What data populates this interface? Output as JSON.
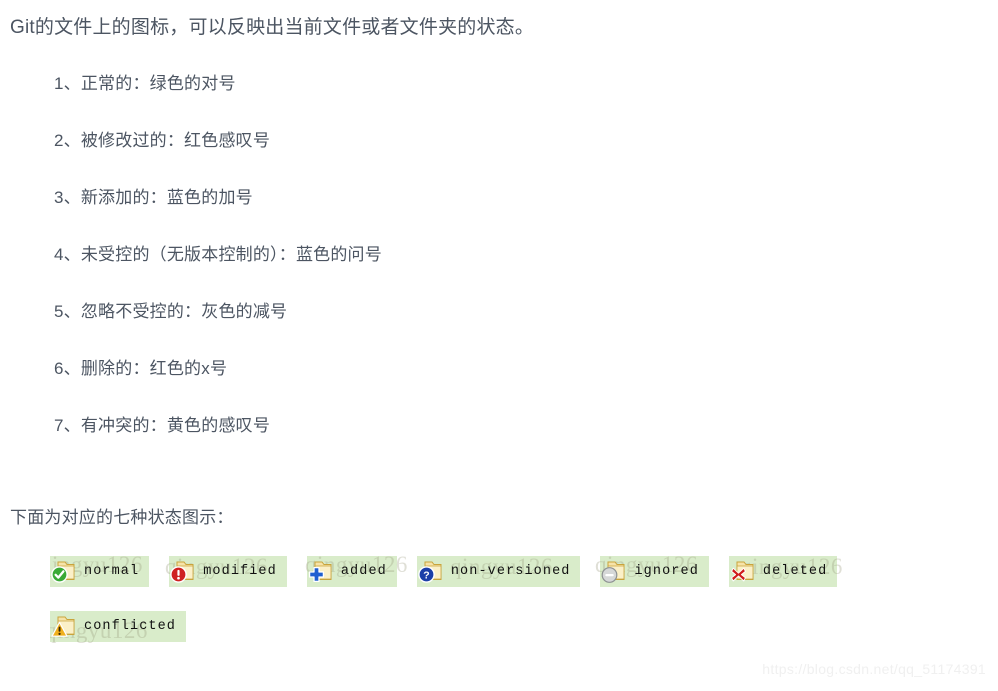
{
  "page": {
    "intro": "Git的文件上的图标，可以反映出当前文件或者文件夹的状态。",
    "sub_heading": "下面为对应的七种状态图示：",
    "watermark": "https://blog.csdn.net/qq_51174391",
    "background_watermark_text": "qingyu126",
    "text_color": "#4c5562",
    "chip_background": "#d9ecca",
    "page_background": "#ffffff"
  },
  "status_list": [
    {
      "index": "1、",
      "text": "正常的：绿色的对号"
    },
    {
      "index": "2、",
      "text": "被修改过的：红色感叹号"
    },
    {
      "index": "3、",
      "text": "新添加的：蓝色的加号"
    },
    {
      "index": "4、",
      "text": "未受控的（无版本控制的）：蓝色的问号"
    },
    {
      "index": "5、",
      "text": "忽略不受控的：灰色的减号"
    },
    {
      "index": "6、",
      "text": "删除的：红色的x号"
    },
    {
      "index": "7、",
      "text": "有冲突的：黄色的感叹号"
    }
  ],
  "legend": {
    "row1": [
      {
        "label": "normal",
        "badge": "green-check-badge",
        "badge_color": "#3aa935"
      },
      {
        "label": "modified",
        "badge": "red-exclamation-badge",
        "badge_color": "#cf2020"
      },
      {
        "label": "added",
        "badge": "blue-plus-badge",
        "badge_color": "#1f5fd0"
      },
      {
        "label": "non-versioned",
        "badge": "blue-question-badge",
        "badge_color": "#1b3fa8"
      },
      {
        "label": "ignored",
        "badge": "gray-minus-badge",
        "badge_color": "#b9bcbd"
      },
      {
        "label": "deleted",
        "badge": "red-cross-badge",
        "badge_color": "#d01c1c"
      }
    ],
    "row2": [
      {
        "label": "conflicted",
        "badge": "yellow-warning-badge",
        "badge_color": "#f0b01d"
      }
    ]
  }
}
